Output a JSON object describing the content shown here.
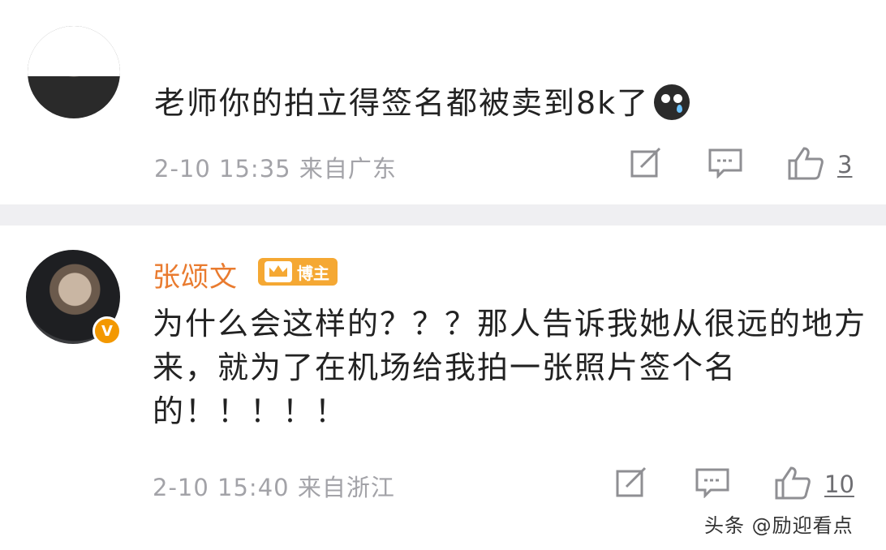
{
  "comments": [
    {
      "text": "老师你的拍立得签名都被卖到8k了",
      "emoji": "crying-face-icon",
      "meta": "2-10 15:35 来自广东",
      "likes": "3"
    },
    {
      "username": "张颂文",
      "host_badge": "博主",
      "verified_badge": "V",
      "text": "为什么会这样的？？？那人告诉我她从很远的地方来，就为了在机场给我拍一张照片签个名的！！！！！",
      "meta": "2-10 15:40 来自浙江",
      "likes": "10"
    }
  ],
  "watermark": "头条 @励迎看点",
  "colors": {
    "username": "#e97b2f",
    "badge": "#f5a833",
    "meta": "#a3a3a8",
    "divider": "#efeff2"
  }
}
